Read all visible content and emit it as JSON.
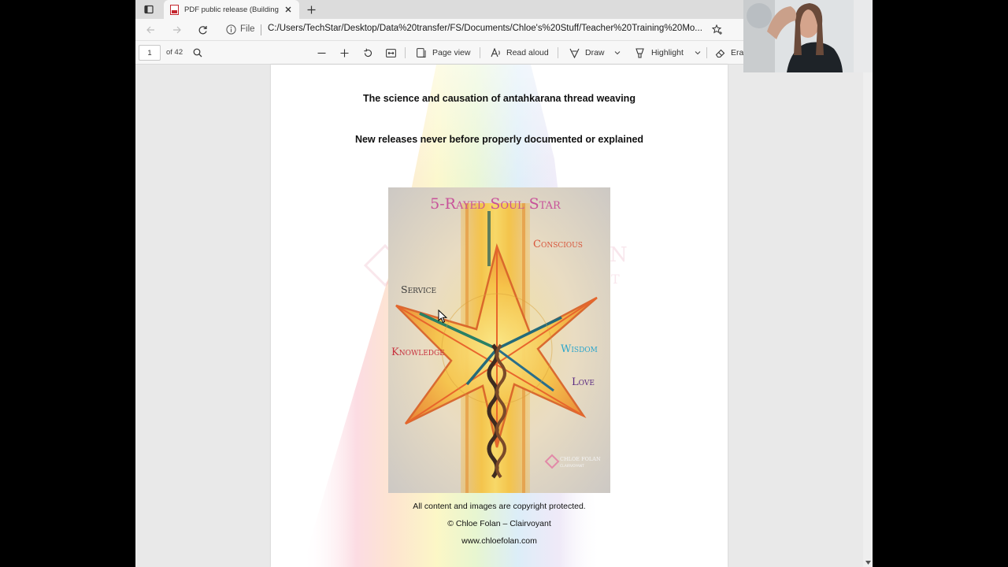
{
  "tab": {
    "title": "PDF public release (Building the"
  },
  "address_bar": {
    "scheme_label": "File",
    "url": "C:/Users/TechStar/Desktop/Data%20transfer/FS/Documents/Chloe's%20Stuff/Teacher%20Training%20Mo..."
  },
  "pdf_toolbar": {
    "page_number": "1",
    "page_total": "of 42",
    "page_view_label": "Page view",
    "read_aloud_label": "Read aloud",
    "draw_label": "Draw",
    "highlight_label": "Highlight",
    "erase_label": "Era"
  },
  "document": {
    "heading_1": "The science and causation of antahkarana thread weaving",
    "heading_2": "New releases never before properly documented or explained",
    "artwork": {
      "title": "5-Rayed Soul Star",
      "labels": {
        "conscious": "Conscious",
        "service": "Service",
        "knowledge": "Knowledge",
        "wisdom": "Wisdom",
        "love": "Love"
      },
      "logo_text": "Chloe Folan Clairvoyant"
    },
    "footer_line_1": "All content and images are copyright protected.",
    "footer_line_2": "© Chloe Folan – Clairvoyant",
    "footer_line_3": "www.chloefolan.com"
  },
  "colors": {
    "accent_pdf_red": "#c4262e",
    "label_conscious": "#d8553a",
    "label_service": "#3a3a3a",
    "label_knowledge": "#c7303d",
    "label_wisdom": "#2ba6cc",
    "label_love": "#5a2a82",
    "title_pink": "#c8529a"
  }
}
